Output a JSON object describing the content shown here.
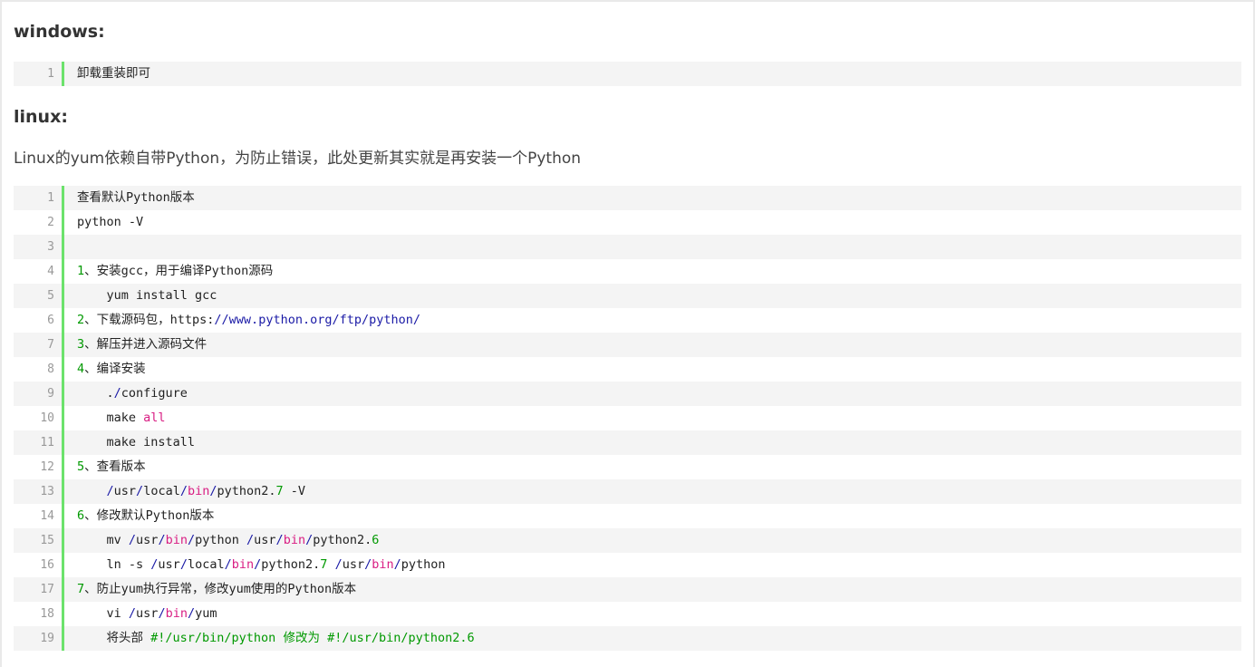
{
  "headings": {
    "windows": "windows:",
    "linux": "linux:"
  },
  "linux_note": "Linux的yum依赖自带Python，为防止错误，此处更新其实就是再安装一个Python",
  "windows_code": {
    "lines": [
      {
        "n": "1",
        "parts": [
          {
            "t": "卸载重装即可",
            "c": ""
          }
        ]
      }
    ]
  },
  "linux_code": {
    "lines": [
      {
        "n": "1",
        "parts": [
          {
            "t": "查看默认Python版本",
            "c": ""
          }
        ]
      },
      {
        "n": "2",
        "parts": [
          {
            "t": "python -V",
            "c": ""
          }
        ]
      },
      {
        "n": "3",
        "parts": []
      },
      {
        "n": "4",
        "parts": [
          {
            "t": "1",
            "c": "num"
          },
          {
            "t": "、安装gcc，用于编译Python源码",
            "c": ""
          }
        ]
      },
      {
        "n": "5",
        "parts": [
          {
            "t": "    yum install gcc",
            "c": ""
          }
        ]
      },
      {
        "n": "6",
        "parts": [
          {
            "t": "2",
            "c": "num"
          },
          {
            "t": "、下载源码包，https:",
            "c": ""
          },
          {
            "t": "//www.python.org/ftp/python/",
            "c": "pth"
          }
        ]
      },
      {
        "n": "7",
        "parts": [
          {
            "t": "3",
            "c": "num"
          },
          {
            "t": "、解压并进入源码文件",
            "c": ""
          }
        ]
      },
      {
        "n": "8",
        "parts": [
          {
            "t": "4",
            "c": "num"
          },
          {
            "t": "、编译安装",
            "c": ""
          }
        ]
      },
      {
        "n": "9",
        "parts": [
          {
            "t": "    .",
            "c": ""
          },
          {
            "t": "/",
            "c": "pth"
          },
          {
            "t": "configure",
            "c": ""
          }
        ]
      },
      {
        "n": "10",
        "parts": [
          {
            "t": "    make ",
            "c": ""
          },
          {
            "t": "all",
            "c": "kw"
          }
        ]
      },
      {
        "n": "11",
        "parts": [
          {
            "t": "    make install",
            "c": ""
          }
        ]
      },
      {
        "n": "12",
        "parts": [
          {
            "t": "5",
            "c": "num"
          },
          {
            "t": "、查看版本",
            "c": ""
          }
        ]
      },
      {
        "n": "13",
        "parts": [
          {
            "t": "    ",
            "c": ""
          },
          {
            "t": "/",
            "c": "pth"
          },
          {
            "t": "usr",
            "c": ""
          },
          {
            "t": "/",
            "c": "pth"
          },
          {
            "t": "local",
            "c": ""
          },
          {
            "t": "/",
            "c": "pth"
          },
          {
            "t": "bin",
            "c": "kw"
          },
          {
            "t": "/",
            "c": "pth"
          },
          {
            "t": "python2.",
            "c": ""
          },
          {
            "t": "7",
            "c": "num"
          },
          {
            "t": " -V",
            "c": ""
          }
        ]
      },
      {
        "n": "14",
        "parts": [
          {
            "t": "6",
            "c": "num"
          },
          {
            "t": "、修改默认Python版本",
            "c": ""
          }
        ]
      },
      {
        "n": "15",
        "parts": [
          {
            "t": "    mv ",
            "c": ""
          },
          {
            "t": "/",
            "c": "pth"
          },
          {
            "t": "usr",
            "c": ""
          },
          {
            "t": "/",
            "c": "pth"
          },
          {
            "t": "bin",
            "c": "kw"
          },
          {
            "t": "/",
            "c": "pth"
          },
          {
            "t": "python ",
            "c": ""
          },
          {
            "t": "/",
            "c": "pth"
          },
          {
            "t": "usr",
            "c": ""
          },
          {
            "t": "/",
            "c": "pth"
          },
          {
            "t": "bin",
            "c": "kw"
          },
          {
            "t": "/",
            "c": "pth"
          },
          {
            "t": "python2.",
            "c": ""
          },
          {
            "t": "6",
            "c": "num"
          }
        ]
      },
      {
        "n": "16",
        "parts": [
          {
            "t": "    ln -s ",
            "c": ""
          },
          {
            "t": "/",
            "c": "pth"
          },
          {
            "t": "usr",
            "c": ""
          },
          {
            "t": "/",
            "c": "pth"
          },
          {
            "t": "local",
            "c": ""
          },
          {
            "t": "/",
            "c": "pth"
          },
          {
            "t": "bin",
            "c": "kw"
          },
          {
            "t": "/",
            "c": "pth"
          },
          {
            "t": "python2.",
            "c": ""
          },
          {
            "t": "7",
            "c": "num"
          },
          {
            "t": " ",
            "c": ""
          },
          {
            "t": "/",
            "c": "pth"
          },
          {
            "t": "usr",
            "c": ""
          },
          {
            "t": "/",
            "c": "pth"
          },
          {
            "t": "bin",
            "c": "kw"
          },
          {
            "t": "/",
            "c": "pth"
          },
          {
            "t": "python",
            "c": ""
          }
        ]
      },
      {
        "n": "17",
        "parts": [
          {
            "t": "7",
            "c": "num"
          },
          {
            "t": "、防止yum执行异常，修改yum使用的Python版本",
            "c": ""
          }
        ]
      },
      {
        "n": "18",
        "parts": [
          {
            "t": "    vi ",
            "c": ""
          },
          {
            "t": "/",
            "c": "pth"
          },
          {
            "t": "usr",
            "c": ""
          },
          {
            "t": "/",
            "c": "pth"
          },
          {
            "t": "bin",
            "c": "kw"
          },
          {
            "t": "/",
            "c": "pth"
          },
          {
            "t": "yum",
            "c": ""
          }
        ]
      },
      {
        "n": "19",
        "parts": [
          {
            "t": "    将头部 ",
            "c": ""
          },
          {
            "t": "#!/usr/bin/python 修改为 #!/usr/bin/python2.6",
            "c": "cm"
          }
        ]
      }
    ]
  },
  "colors": {
    "gutter_bar": "#6ce26c",
    "number": "#009900",
    "keyword": "#d91e83",
    "path_sep": "#1a1aa6",
    "comment": "#009900",
    "alt_row": "#f4f4f4"
  }
}
